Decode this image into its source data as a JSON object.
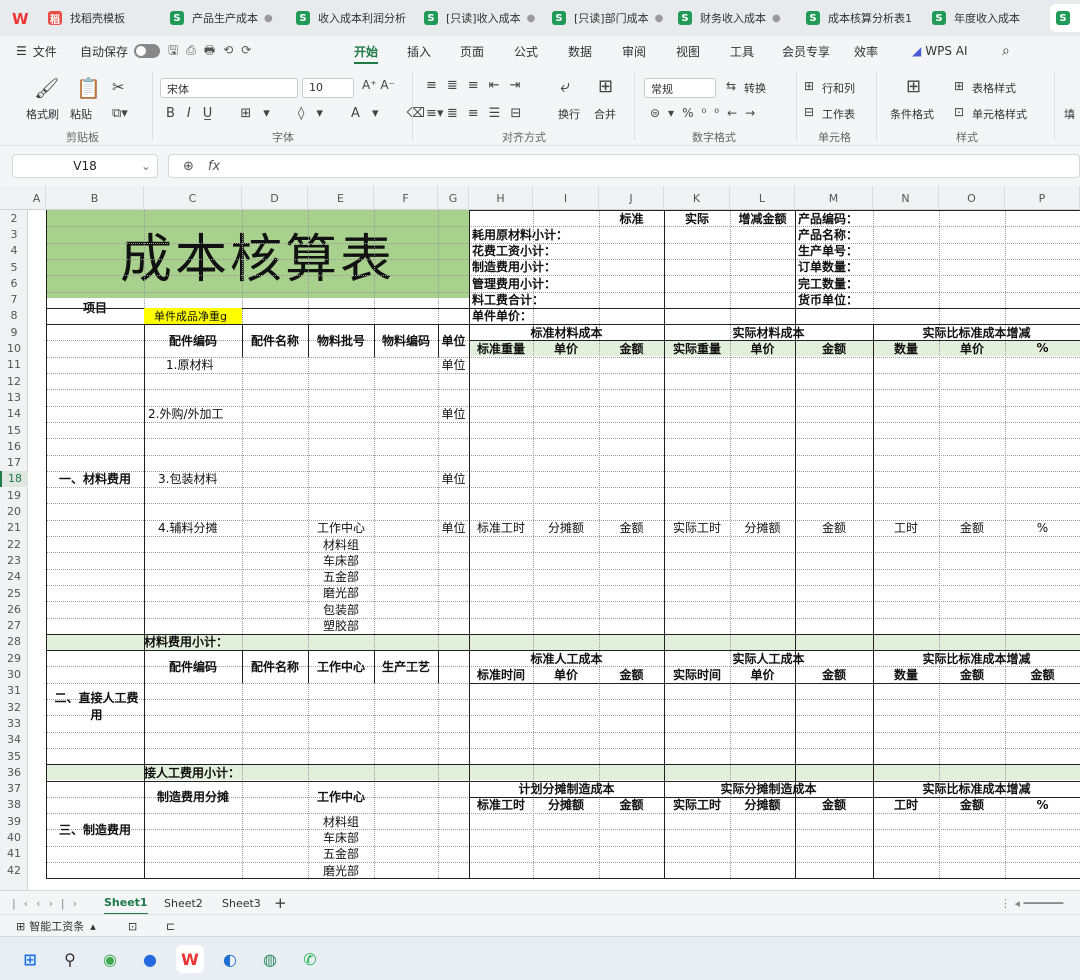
{
  "tabs": [
    {
      "label": "找稻壳模板",
      "type": "template"
    },
    {
      "label": "产品生产成本",
      "type": "sheet"
    },
    {
      "label": "收入成本利润分析",
      "type": "sheet"
    },
    {
      "label": "[只读]收入成本",
      "type": "sheet"
    },
    {
      "label": "[只读]部门成本",
      "type": "sheet"
    },
    {
      "label": "财务收入成本",
      "type": "sheet"
    },
    {
      "label": "成本核算分析表1",
      "type": "sheet"
    },
    {
      "label": "年度收入成本",
      "type": "sheet"
    }
  ],
  "menu": {
    "file": "文件",
    "autosave": "自动保存",
    "items": [
      "开始",
      "插入",
      "页面",
      "公式",
      "数据",
      "审阅",
      "视图",
      "工具",
      "会员专享",
      "效率"
    ],
    "wps_ai": "WPS AI",
    "active": "开始"
  },
  "ribbon": {
    "format_painter": "格式刷",
    "paste": "粘贴",
    "clipboard": "剪贴板",
    "font_name": "宋体",
    "font_size": "10",
    "font_group": "字体",
    "wrap": "换行",
    "merge": "合并",
    "align_group": "对齐方式",
    "number_format": "常规",
    "convert": "转换",
    "number_group": "数字格式",
    "rows_cols": "行和列",
    "worksheet": "工作表",
    "cell_group": "单元格",
    "cond_format": "条件格式",
    "table_style": "表格样式",
    "cell_style": "单元格样式",
    "style_group": "样式",
    "fill": "填"
  },
  "formula_bar": {
    "name_box": "V18",
    "fx": "fx",
    "content": ""
  },
  "columns": [
    "A",
    "B",
    "C",
    "D",
    "E",
    "F",
    "G",
    "H",
    "I",
    "J",
    "K",
    "L",
    "M",
    "N",
    "O",
    "P"
  ],
  "rows": [
    "2",
    "3",
    "4",
    "5",
    "6",
    "7",
    "8",
    "9",
    "10",
    "11",
    "12",
    "13",
    "14",
    "15",
    "16",
    "17",
    "18",
    "19",
    "20",
    "21",
    "22",
    "23",
    "24",
    "25",
    "26",
    "27",
    "28",
    "29",
    "30",
    "31",
    "32",
    "33",
    "34",
    "35",
    "36",
    "37",
    "38",
    "39",
    "40",
    "41",
    "42"
  ],
  "selected_row": "18",
  "sheet": {
    "title": "成本核算表",
    "hdr_standard": "标准",
    "hdr_actual": "实际",
    "hdr_diff": "增减金额",
    "summary_left": [
      "耗用原材料小计：",
      "花费工资小计：",
      "制造费用小计：",
      "管理费用小计：",
      "料工费合计：",
      "单件单价："
    ],
    "summary_right": [
      "产品编码：",
      "产品名称：",
      "生产单号：",
      "订单数量：",
      "完工数量：",
      "货币单位："
    ],
    "item": "项目",
    "net_weight": "单件成品净重g",
    "sec1": "一、材料费用",
    "s1_headers": [
      "配件编码",
      "配件名称",
      "物料批号",
      "物料编码",
      "单位"
    ],
    "s1_groups": [
      "标准材料成本",
      "实际材料成本",
      "实际比标准成本增减"
    ],
    "s1_subs": [
      "标准重量",
      "单价",
      "金额",
      "实际重量",
      "单价",
      "金额",
      "数量",
      "单价",
      "%"
    ],
    "raw": "1.原材料",
    "outsource": "2.外购/外加工",
    "pack": "3.包装材料",
    "aux": "4.辅料分摊",
    "unit": "单位",
    "aux_subs": [
      "标准工时",
      "分摊额",
      "金额",
      "实际工时",
      "分摊额",
      "金额",
      "工时",
      "金额",
      "%"
    ],
    "work_center": "工作中心",
    "centers": [
      "材料组",
      "车床部",
      "五金部",
      "磨光部",
      "包装部",
      "塑胶部"
    ],
    "s1_subtotal": "材料费用小计：",
    "sec2": "二、直接人工费用",
    "s2_headers": [
      "配件编码",
      "配件名称",
      "工作中心",
      "生产工艺"
    ],
    "s2_groups": [
      "标准人工成本",
      "实际人工成本",
      "实际比标准成本增减"
    ],
    "s2_subs": [
      "标准时间",
      "单价",
      "金额",
      "实际时间",
      "单价",
      "金额",
      "数量",
      "金额",
      "金额"
    ],
    "s2_subtotal": "接人工费用小计：",
    "sec3": "三、制造费用",
    "s3_header": "制造费用分摊",
    "s3_center": "工作中心",
    "s3_groups": [
      "计划分摊制造成本",
      "实际分摊制造成本",
      "实际比标准成本增减"
    ],
    "s3_subs": [
      "标准工时",
      "分摊额",
      "金额",
      "实际工时",
      "分摊额",
      "金额",
      "工时",
      "金额",
      "%"
    ],
    "s3_centers": [
      "材料组",
      "车床部",
      "五金部",
      "磨光部"
    ]
  },
  "sheet_tabs": [
    "Sheet1",
    "Sheet2",
    "Sheet3"
  ],
  "active_sheet": "Sheet1",
  "status": {
    "smart": "智能工资条"
  },
  "colors": {
    "title_bg": "#a9d18e",
    "yellow": "#ffff00",
    "subtotal_bg": "#e2efda",
    "accent": "#1f7a46"
  }
}
